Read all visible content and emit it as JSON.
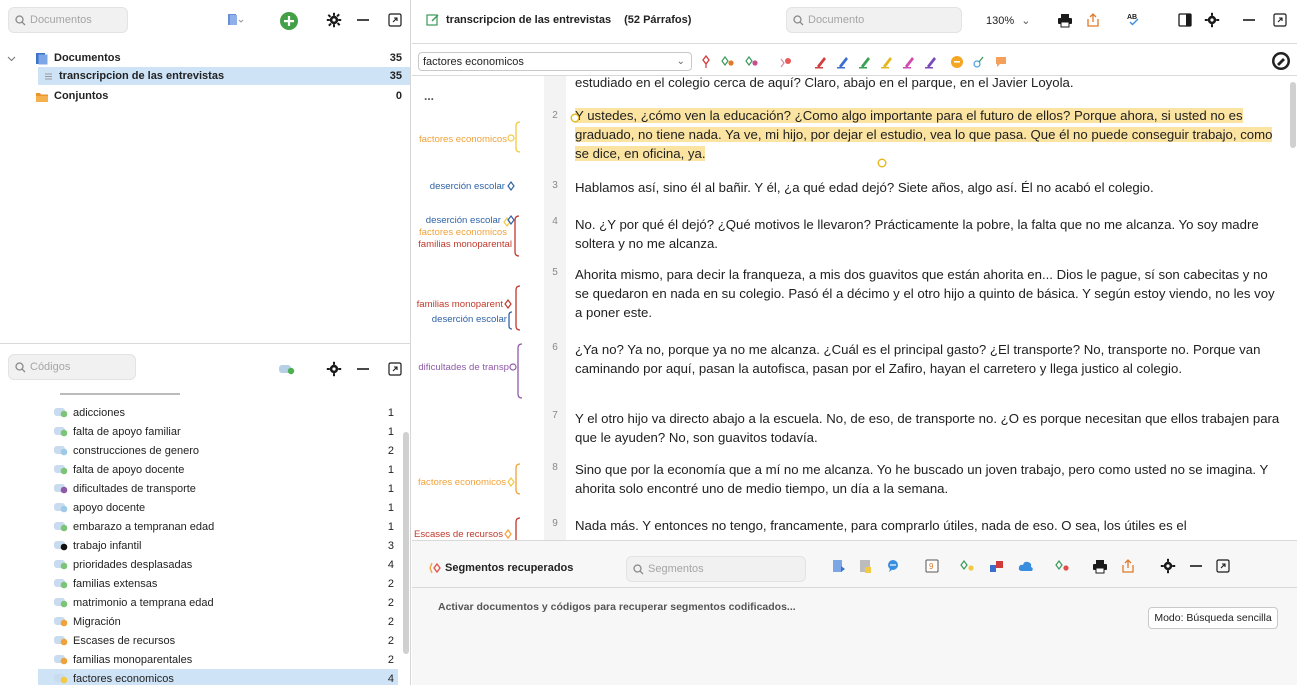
{
  "documents_pane": {
    "search_placeholder": "Documentos",
    "tree": [
      {
        "label": "Documentos",
        "count": "35"
      },
      {
        "label": "transcripcion de las entrevistas",
        "count": "35"
      },
      {
        "label": "Conjuntos",
        "count": "0"
      }
    ]
  },
  "codes_pane": {
    "search_placeholder": "Códigos",
    "codes": [
      {
        "label": "adicciones",
        "count": "1",
        "color": "#7cc576"
      },
      {
        "label": "falta de apoyo familiar",
        "count": "1",
        "color": "#7cc576"
      },
      {
        "label": "construcciones de genero",
        "count": "2",
        "color": "#9fc9e8"
      },
      {
        "label": "falta de apoyo docente",
        "count": "1",
        "color": "#7cc576"
      },
      {
        "label": "dificultades de transporte",
        "count": "1",
        "color": "#8e5aa8"
      },
      {
        "label": "apoyo docente",
        "count": "1",
        "color": "#9fc9e8"
      },
      {
        "label": "embarazo a tempranan edad",
        "count": "1",
        "color": "#7cc576"
      },
      {
        "label": "trabajo infantil",
        "count": "3",
        "color": "#111111"
      },
      {
        "label": "prioridades desplasadas",
        "count": "4",
        "color": "#7cc576"
      },
      {
        "label": "familias extensas",
        "count": "2",
        "color": "#7cc576"
      },
      {
        "label": "matrimonio a temprana edad",
        "count": "2",
        "color": "#7cc576"
      },
      {
        "label": "Migración",
        "count": "2",
        "color": "#f0a23a"
      },
      {
        "label": "Escases de recursos",
        "count": "2",
        "color": "#f0a23a"
      },
      {
        "label": "familias monoparentales",
        "count": "2",
        "color": "#f0a23a"
      },
      {
        "label": "factores economicos",
        "count": "4",
        "color": "#f3c842"
      }
    ]
  },
  "document_browser": {
    "title": "transcripcion de las entrevistas",
    "paragraph_count": "(52 Párrafos)",
    "search_placeholder": "Documento",
    "zoom": "130%",
    "code_select": "factores economicos",
    "top_line": "estudiado en el colegio cerca de aquí? Claro, abajo en el parque, en el Javier Loyola.",
    "ellipsis": "...",
    "paragraphs": [
      {
        "num": "2",
        "text": "Y ustedes, ¿cómo ven la educación? ¿Como algo importante para el futuro de ellos? Porque ahora, si usted no es graduado, no tiene nada. Ya ve, mi hijo, por dejar el estudio, vea lo que pasa. Que él no puede conseguir trabajo, como se dice, en oficina, ya."
      },
      {
        "num": "3",
        "text": "Hablamos así, sino él al bañir. Y él, ¿a qué edad dejó? Siete años, algo así. Él no acabó el colegio."
      },
      {
        "num": "4",
        "text": "No. ¿Y por qué él dejó? ¿Qué motivos le llevaron? Prácticamente la pobre, la falta que no me alcanza. Yo soy madre soltera y no me alcanza."
      },
      {
        "num": "5",
        "text": "Ahorita mismo, para decir la franqueza, a mis dos guavitos que están ahorita en... Dios le pague, sí son cabecitas y no se quedaron en nada en su colegio. Pasó él a décimo y el otro hijo a quinto de básica. Y según estoy viendo, no les voy a poner este."
      },
      {
        "num": "6",
        "text": "¿Ya no? Ya no, porque ya no me alcanza. ¿Cuál es el principal gasto? ¿El transporte? No, transporte no. Porque van caminando por aquí, pasan la autofisca, pasan por el Zafiro, hayan el carretero y llega justico al colegio."
      },
      {
        "num": "7",
        "text": "Y el otro hijo va directo abajo a la escuela. No, de eso, de transporte no. ¿O es porque necesitan que ellos trabajen para que le ayuden? No, son guavitos todavía."
      },
      {
        "num": "8",
        "text": "Sino que por la economía que a mí no me alcanza. Yo he buscado un joven trabajo, pero como usted no se imagina. Y ahorita solo encontré uno de medio tiempo, un día a la semana."
      },
      {
        "num": "9",
        "text": "Nada más. Y entonces no tengo, francamente, para comprarlo útiles, nada de eso. O sea, los útiles es el"
      }
    ],
    "margin_codes": {
      "p2": "factores economicos",
      "p3": "deserción escolar",
      "p4a": "deserción escolar",
      "p4b": "factores economicos",
      "p4c": "familias monoparental",
      "p5a": "familias monoparent",
      "p5b": "deserción escolar",
      "p6": "dificultades de transp",
      "p8": "factores economicos",
      "p9": "Escases de recursos"
    }
  },
  "segments_pane": {
    "title": "Segmentos recuperados",
    "search_placeholder": "Segmentos",
    "message": "Activar documentos y códigos para recuperar segmentos codificados...",
    "mode_button": "Modo: Búsqueda sencilla"
  },
  "colors": {
    "highlight": "#fbe3a1",
    "selection": "#cfe3f7",
    "economicos": "#f3c842",
    "desercion": "#2f63a5",
    "monoparental": "#c0392b",
    "transporte": "#8e5aa8"
  }
}
